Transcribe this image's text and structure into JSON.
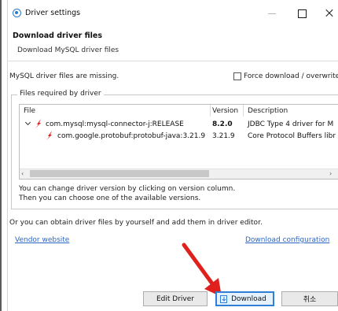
{
  "window": {
    "title": "Driver settings",
    "icon": "driver-settings-icon"
  },
  "header": {
    "title": "Download driver files",
    "subtitle": "Download MySQL driver files"
  },
  "body": {
    "missing_text": "MySQL driver files are missing.",
    "force_download_label": "Force download / overwrite",
    "force_download_checked": false
  },
  "files_group": {
    "legend": "Files required by driver",
    "columns": [
      "File",
      "Version",
      "Description"
    ],
    "rows": [
      {
        "file": "com.mysql:mysql-connector-j:RELEASE",
        "version": "8.2.0",
        "description": "JDBC Type 4 driver for M",
        "expanded": true,
        "icon": "jar-library-icon"
      },
      {
        "file": "com.google.protobuf:protobuf-java:3.21.9",
        "version": "3.21.9",
        "description": "Core Protocol Buffers libr",
        "icon": "jar-library-icon"
      }
    ],
    "hint_line1": "You can change driver version by clicking on version column.",
    "hint_line2": "Then you can choose one of the available versions."
  },
  "footer_info": {
    "obtain_text": "Or you can obtain driver files by yourself and add them in driver editor.",
    "vendor_link": "Vendor website",
    "config_link": "Download configuration"
  },
  "buttons": {
    "edit_driver": "Edit Driver",
    "download": "Download",
    "cancel": "취소"
  },
  "colors": {
    "link": "#2b66c5",
    "accent": "#2f7fd6",
    "arrow": "#e0201c"
  }
}
